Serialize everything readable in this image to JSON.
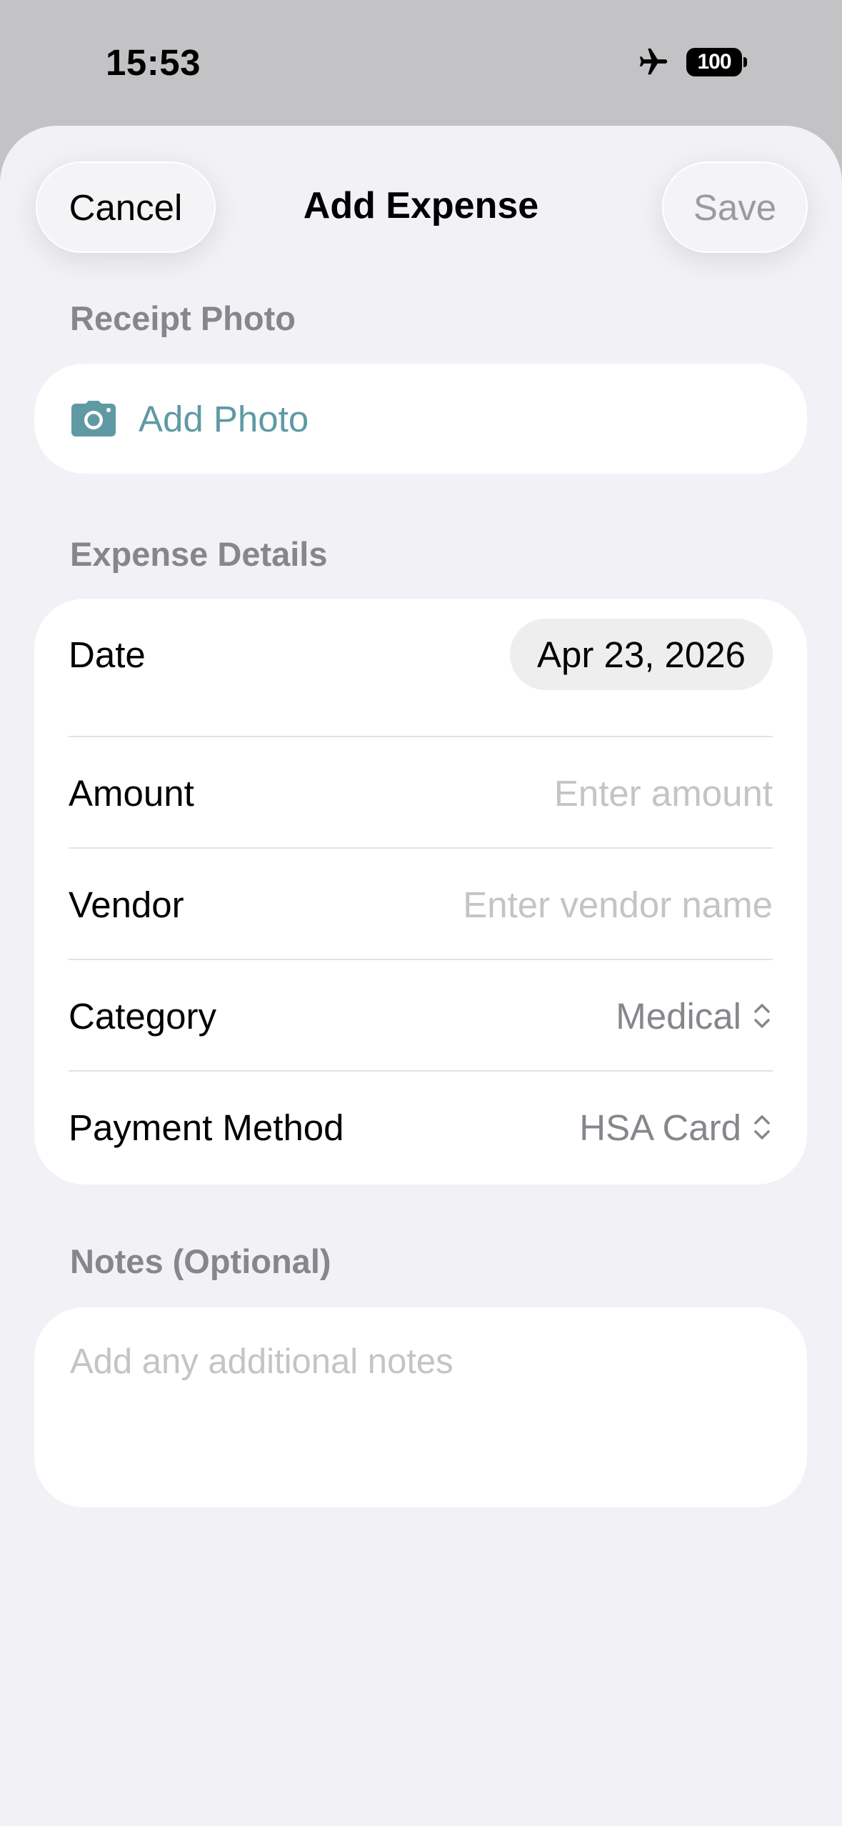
{
  "status_bar": {
    "time": "15:53",
    "battery": "100",
    "airplane_icon": "airplane-icon"
  },
  "nav": {
    "cancel_label": "Cancel",
    "title": "Add Expense",
    "save_label": "Save"
  },
  "receipt": {
    "section_label": "Receipt Photo",
    "add_photo_label": "Add Photo",
    "icon": "camera-icon"
  },
  "details": {
    "section_label": "Expense Details",
    "date_label": "Date",
    "date_value": "Apr 23, 2026",
    "amount_label": "Amount",
    "amount_placeholder": "Enter amount",
    "vendor_label": "Vendor",
    "vendor_placeholder": "Enter vendor name",
    "category_label": "Category",
    "category_value": "Medical",
    "payment_label": "Payment Method",
    "payment_value": "HSA Card"
  },
  "notes": {
    "section_label": "Notes (Optional)",
    "placeholder": "Add any additional notes"
  },
  "colors": {
    "accent": "#5f9aa4",
    "background": "#f1f1f6",
    "secondary_text": "#86868c"
  }
}
